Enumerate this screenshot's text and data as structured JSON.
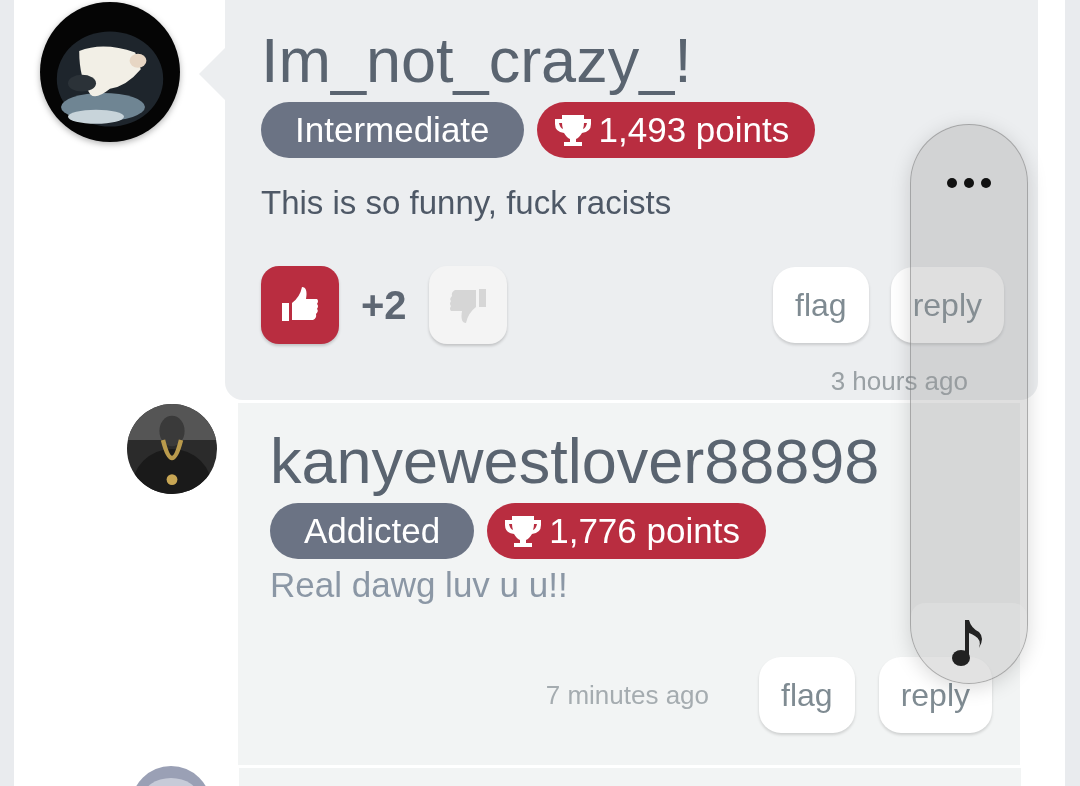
{
  "comments": [
    {
      "kind": "bubble",
      "avatar": {
        "kind": "picture"
      },
      "username": "Im_not_crazy_!",
      "level_badge": "Intermediate",
      "points": "1,493 points",
      "text": "This is so funny, fuck racists",
      "votes": [
        {
          "kind": "up",
          "selected": true
        },
        {
          "kind": "down",
          "selected": false
        }
      ],
      "score": "+2",
      "actions": [
        "flag",
        "reply"
      ],
      "time": "3 hours ago"
    },
    {
      "kind": "card",
      "avatar": {
        "kind": "picture"
      },
      "username": "kanyewestlover88898",
      "level_badge": "Addicted",
      "points": "1,776 points",
      "text": "Real dawg luv u u!!",
      "actions": [
        "flag",
        "reply"
      ],
      "time": "7 minutes ago"
    },
    {
      "kind": "stub",
      "avatar": {
        "kind": "picture"
      }
    }
  ]
}
